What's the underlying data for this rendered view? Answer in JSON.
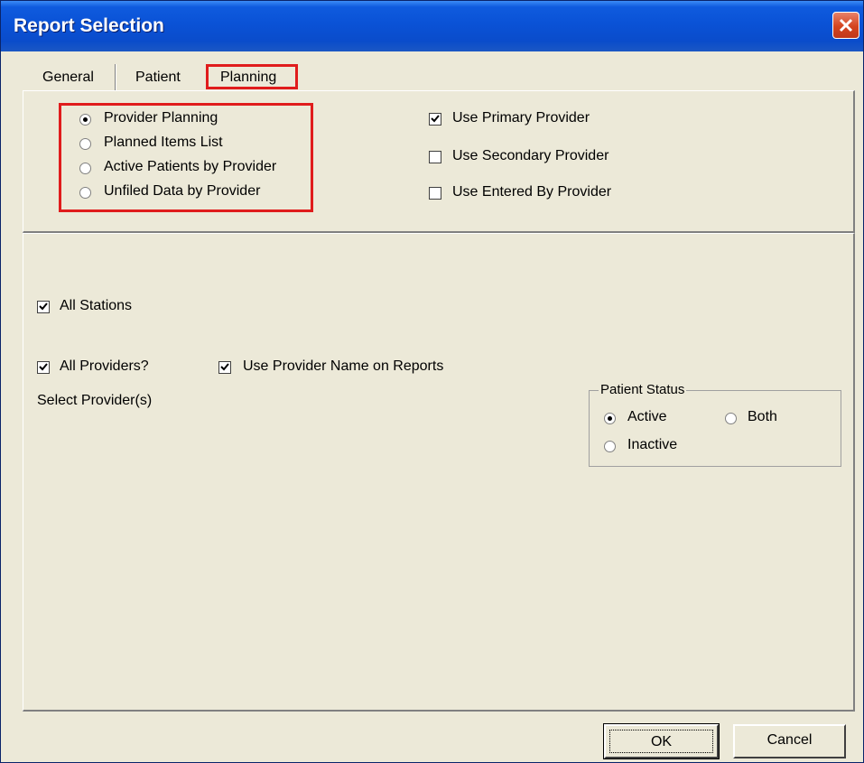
{
  "window": {
    "title": "Report Selection"
  },
  "tabs": [
    {
      "label": "General"
    },
    {
      "label": "Patient"
    },
    {
      "label": "Planning"
    }
  ],
  "report_types": [
    {
      "label": "Provider Planning",
      "selected": true
    },
    {
      "label": "Planned Items List",
      "selected": false
    },
    {
      "label": "Active Patients by Provider",
      "selected": false
    },
    {
      "label": "Unfiled Data by Provider",
      "selected": false
    }
  ],
  "provider_options": [
    {
      "label": "Use Primary Provider",
      "checked": true
    },
    {
      "label": "Use Secondary Provider",
      "checked": false
    },
    {
      "label": "Use Entered By Provider",
      "checked": false
    }
  ],
  "filters": {
    "all_stations": {
      "label": "All Stations",
      "checked": true
    },
    "all_providers": {
      "label": "All Providers?",
      "checked": true
    },
    "use_provider_name": {
      "label": "Use Provider Name on Reports",
      "checked": true
    },
    "select_providers_label": "Select Provider(s)"
  },
  "patient_status": {
    "title": "Patient Status",
    "options": [
      {
        "label": "Active",
        "selected": true
      },
      {
        "label": "Both",
        "selected": false
      },
      {
        "label": "Inactive",
        "selected": false
      }
    ]
  },
  "buttons": {
    "ok": "OK",
    "cancel": "Cancel"
  },
  "colors": {
    "title_bar": "#0a52d6",
    "highlight": "#e01c1c",
    "dialog_bg": "#ece9d8"
  }
}
